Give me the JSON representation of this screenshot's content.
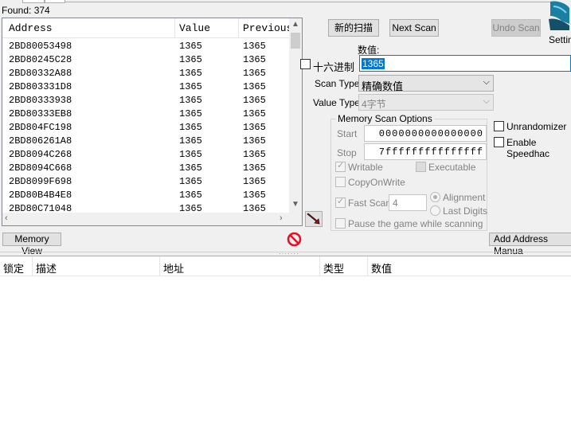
{
  "found": {
    "label": "Found: 374"
  },
  "results": {
    "columns": [
      "Address",
      "Value",
      "Previous"
    ],
    "rows": [
      [
        "2BD80053498",
        "1365",
        "1365"
      ],
      [
        "2BD80245C28",
        "1365",
        "1365"
      ],
      [
        "2BD80332A88",
        "1365",
        "1365"
      ],
      [
        "2BD803331D8",
        "1365",
        "1365"
      ],
      [
        "2BD80333938",
        "1365",
        "1365"
      ],
      [
        "2BD80333EB8",
        "1365",
        "1365"
      ],
      [
        "2BD804FC198",
        "1365",
        "1365"
      ],
      [
        "2BD806261A8",
        "1365",
        "1365"
      ],
      [
        "2BD8094C268",
        "1365",
        "1365"
      ],
      [
        "2BD8094C668",
        "1365",
        "1365"
      ],
      [
        "2BD8099F698",
        "1365",
        "1365"
      ],
      [
        "2BD80B4B4E8",
        "1365",
        "1365"
      ],
      [
        "2BD80C71048",
        "1365",
        "1365"
      ]
    ]
  },
  "buttons": {
    "new_scan": "新的扫描",
    "next_scan": "Next Scan",
    "undo_scan": "Undo Scan",
    "settings": "Settin",
    "memory_view": "Memory View",
    "add_address": "Add Address Manua"
  },
  "scan": {
    "value_label": "数值:",
    "hex_label": "十六进制",
    "value": "1365",
    "scan_type_label": "Scan Type",
    "scan_type": "精确数值",
    "value_type_label": "Value Type",
    "value_type": "4字节"
  },
  "memory_options": {
    "title": "Memory Scan Options",
    "start_label": "Start",
    "start": "0000000000000000",
    "stop_label": "Stop",
    "stop": "7fffffffffffffff",
    "writable": "Writable",
    "executable": "Executable",
    "copy_on_write": "CopyOnWrite",
    "fast_scan": "Fast Scan",
    "fast_scan_value": "4",
    "alignment": "Alignment",
    "last_digits": "Last Digits",
    "pause_game": "Pause the game while scanning"
  },
  "extras": {
    "unrandomizer": "Unrandomizer",
    "speedhack": "Enable Speedhac"
  },
  "address_table": {
    "columns": [
      "锁定",
      "描述",
      "地址",
      "类型",
      "数值"
    ]
  },
  "colors": {
    "accent": "#0078d7",
    "stop_red": "#e81123"
  }
}
